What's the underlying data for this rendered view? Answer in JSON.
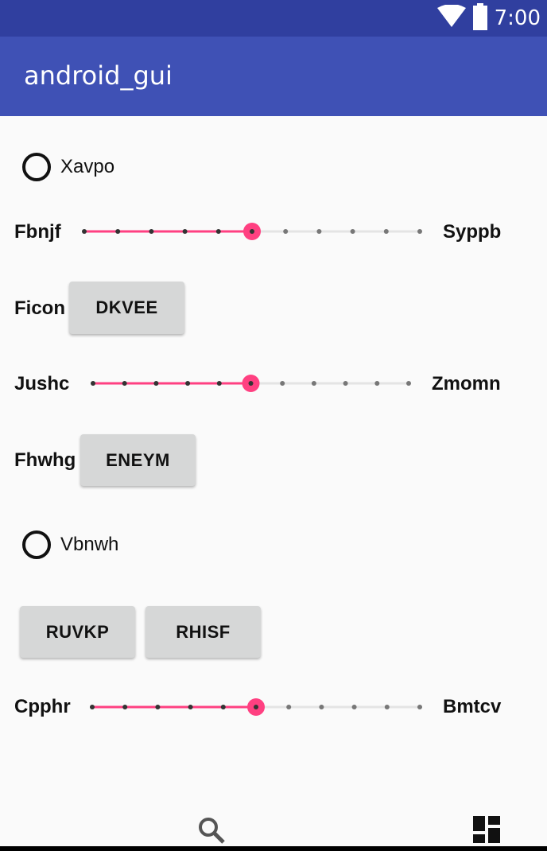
{
  "status_bar": {
    "time": "7:00",
    "icons": [
      "wifi-icon",
      "battery-icon"
    ]
  },
  "app_bar": {
    "title": "android_gui"
  },
  "colors": {
    "primary_dark": "#303f9f",
    "primary": "#3f51b5",
    "accent": "#ff4081",
    "button_bg": "#d6d7d7"
  },
  "radio_1": {
    "label": "Xavpo",
    "checked": false
  },
  "slider_1": {
    "left_label": "Fbnjf",
    "right_label": "Syppb",
    "value": 5,
    "max": 10
  },
  "row_ficon": {
    "label": "Ficon",
    "button": "DKVEE"
  },
  "slider_2": {
    "left_label": "Jushc",
    "right_label": "Zmomn",
    "value": 5,
    "max": 10
  },
  "row_fhwhg": {
    "label": "Fhwhg",
    "button": "ENEYM"
  },
  "radio_2": {
    "label": "Vbnwh",
    "checked": false
  },
  "buttons_row": {
    "left": "RUVKP",
    "right": "RHISF"
  },
  "slider_3": {
    "left_label": "Cpphr",
    "right_label": "Bmtcv",
    "value": 5,
    "max": 10
  },
  "bottom_nav": {
    "icons": [
      "search-icon",
      "dashboard-icon"
    ]
  }
}
